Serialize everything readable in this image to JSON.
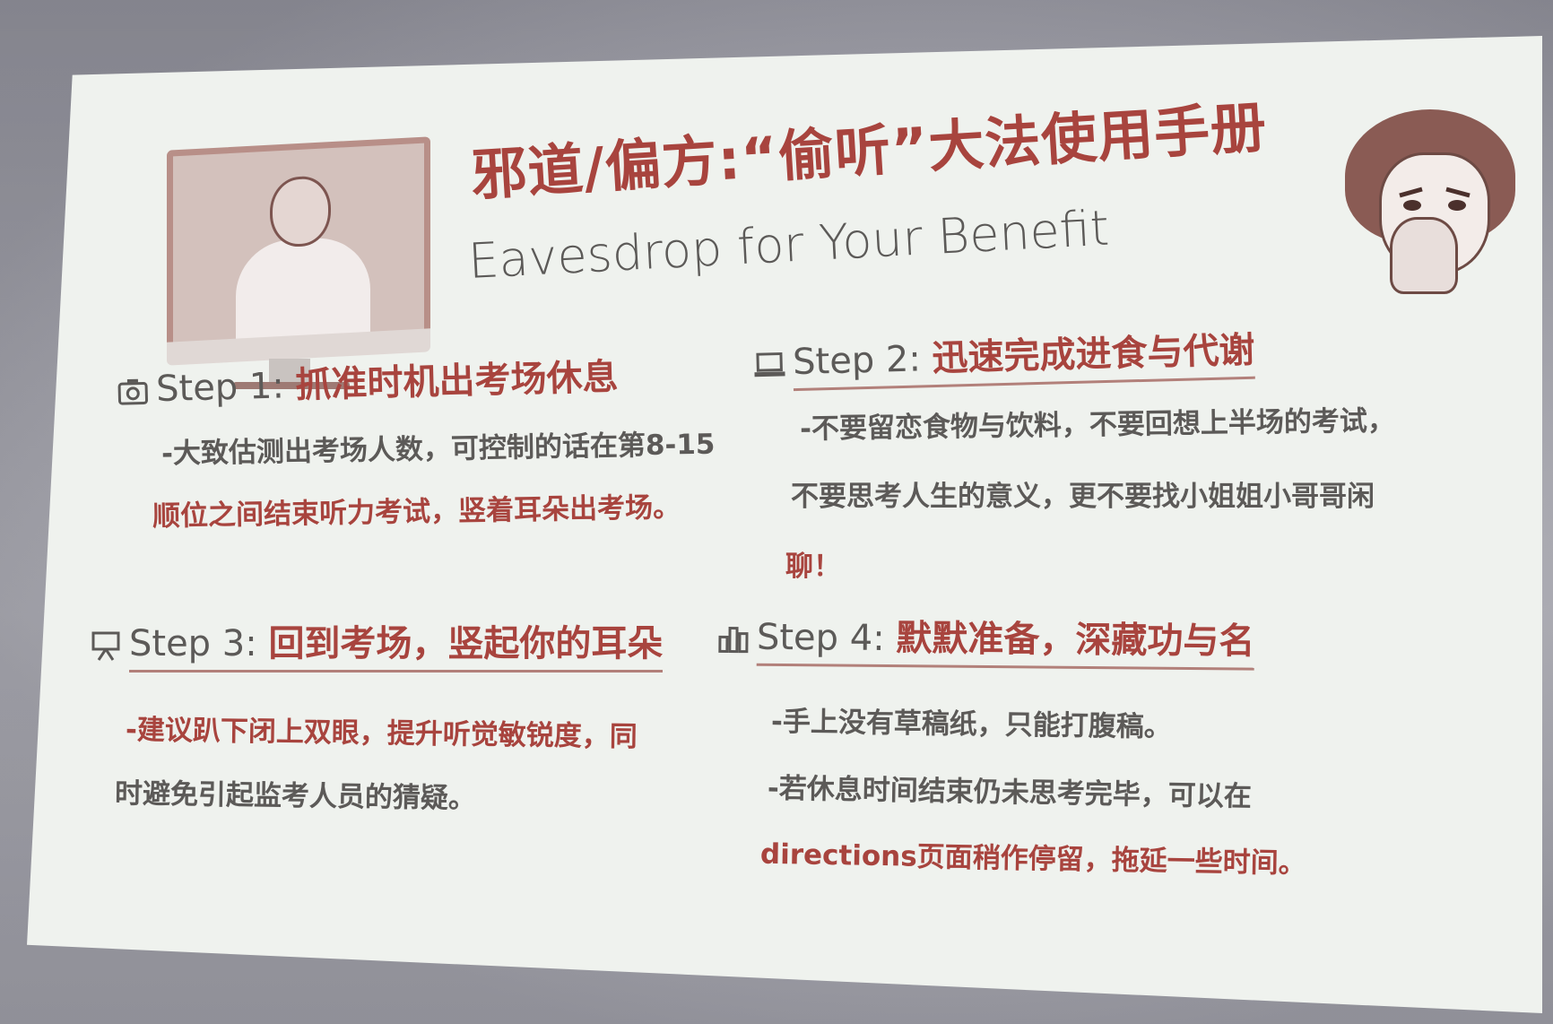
{
  "slide": {
    "title": "邪道/偏方:“偷听”大法使用手册",
    "subtitle": "Eavesdrop for Your Benefit",
    "steps": [
      {
        "label": "Step 1:",
        "heading": "抓准时机出考场休息",
        "lines": [
          "-大致估测出考场人数，可控制的话在第8-15",
          "顺位之间结束听力考试，竖着耳朵出考场。"
        ]
      },
      {
        "label": "Step 2:",
        "heading": "迅速完成进食与代谢",
        "lines": [
          "-不要留恋食物与饮料，不要回想上半场的考试，",
          "不要思考人生的意义，更不要找小姐姐小哥哥闲",
          "聊！"
        ]
      },
      {
        "label": "Step 3:",
        "heading": "回到考场，竖起你的耳朵",
        "lines": [
          "-建议趴下闭上双眼，提升听觉敏锐度，同",
          "时避免引起监考人员的猜疑。"
        ]
      },
      {
        "label": "Step 4:",
        "heading": "默默准备，深藏功与名",
        "lines": [
          "-手上没有草稿纸，只能打腹稿。",
          "-若休息时间结束仍未思考完毕，可以在",
          "directions页面稍作停留，拖延一些时间。"
        ]
      }
    ]
  },
  "colors": {
    "accent": "#a8443e",
    "text": "#5c5a58",
    "slide_bg": "#eff2ee"
  },
  "icons": [
    "monitor-illustration",
    "meme-face",
    "camera-icon",
    "laptop-icon",
    "presentation-icon",
    "bar-chart-icon"
  ]
}
